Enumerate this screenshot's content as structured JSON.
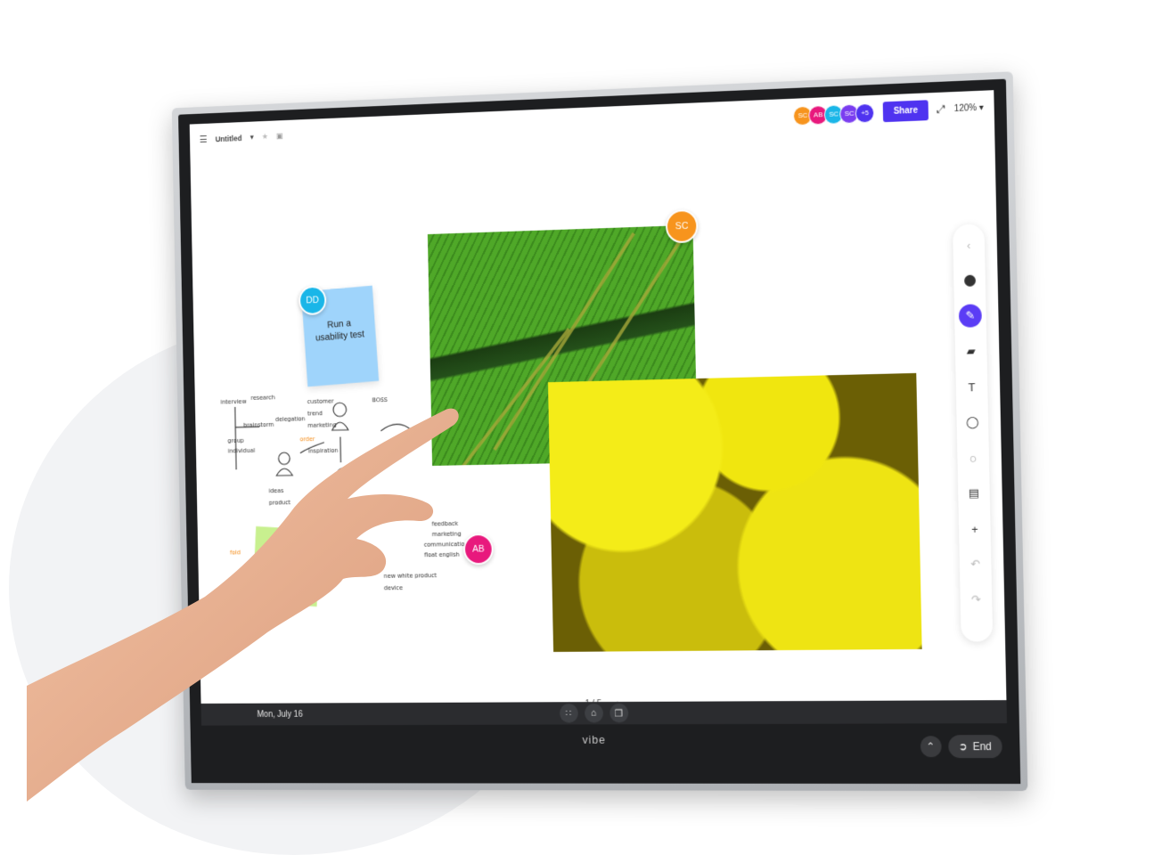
{
  "board": {
    "title": "Untitled",
    "zoom": "120%",
    "share_label": "Share",
    "page_indicator": "1 / 5"
  },
  "collaborators": [
    {
      "initials": "SC",
      "color": "#f7941d"
    },
    {
      "initials": "AB",
      "color": "#e8197d"
    },
    {
      "initials": "SC",
      "color": "#1ab6e8"
    },
    {
      "initials": "SC",
      "color": "#7a3df0"
    },
    {
      "initials": "+5",
      "color": "#4f33f0"
    }
  ],
  "cursors": {
    "dd": {
      "initials": "DD",
      "color": "#1ab6e8"
    },
    "sc": {
      "initials": "SC",
      "color": "#f7941d"
    },
    "ab": {
      "initials": "AB",
      "color": "#e8197d"
    }
  },
  "sticky_note": {
    "text_line1": "Run a",
    "text_line2": "usability test"
  },
  "sketch_words": [
    "customer",
    "trend",
    "marketing",
    "BOSS",
    "interview",
    "research",
    "brainstorm",
    "delegation",
    "group",
    "individual",
    "order",
    "inspiration",
    "ideas",
    "product",
    "fold",
    "feedback",
    "marketing",
    "communication",
    "float english",
    "new white product",
    "device"
  ],
  "taskbar": {
    "date": "Mon, July 16",
    "brand": "vibe",
    "end_label": "End"
  },
  "toolbar": {
    "items": [
      "collapse-icon",
      "color-dot-icon",
      "pen-icon",
      "eraser-icon",
      "text-icon",
      "shapes-icon",
      "lasso-icon",
      "pattern-icon",
      "plus-icon",
      "undo-icon",
      "redo-icon"
    ]
  }
}
